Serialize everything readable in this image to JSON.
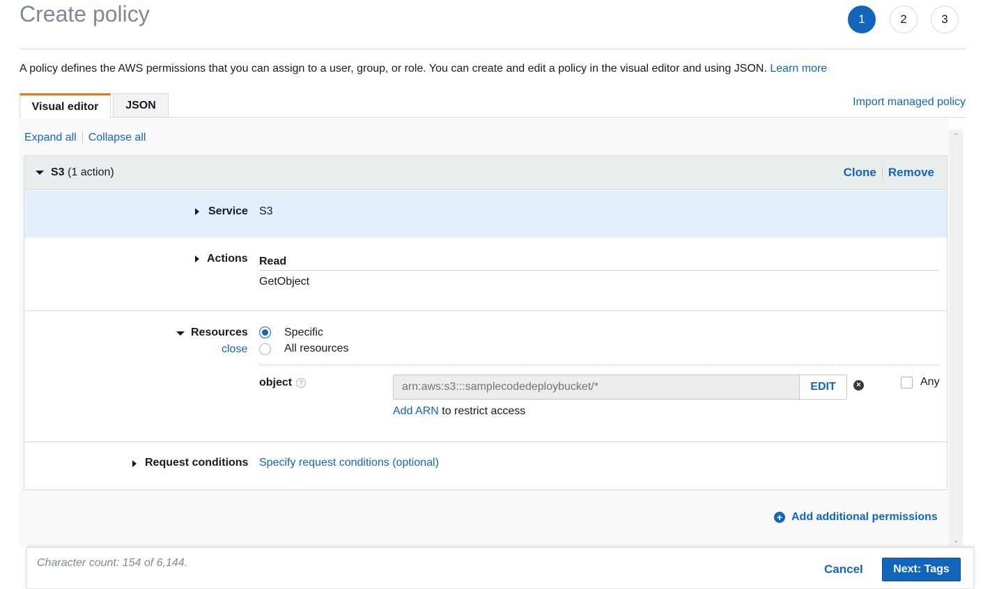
{
  "header": {
    "title": "Create policy",
    "steps": [
      "1",
      "2",
      "3"
    ],
    "description": "A policy defines the AWS permissions that you can assign to a user, group, or role. You can create and edit a policy in the visual editor and using JSON.",
    "learn_more": "Learn more"
  },
  "tabs": {
    "visual": "Visual editor",
    "json": "JSON",
    "import_link": "Import managed policy"
  },
  "toolbar": {
    "expand_all": "Expand all",
    "collapse_all": "Collapse all"
  },
  "permission": {
    "service_short": "S3",
    "action_count": "(1 action)",
    "clone": "Clone",
    "remove": "Remove",
    "service_label": "Service",
    "service_value": "S3",
    "actions_label": "Actions",
    "access_level": "Read",
    "action": "GetObject",
    "resources_label": "Resources",
    "close_link": "close",
    "radio_specific": "Specific",
    "radio_all": "All resources",
    "resource_type": "object",
    "arn_value": "arn:aws:s3:::samplecodedeploybucket/*",
    "edit": "EDIT",
    "any": "Any",
    "add_arn": "Add ARN",
    "restrict_text": "to restrict access",
    "conditions_label": "Request conditions",
    "conditions_link": "Specify request conditions (optional)"
  },
  "add_permissions": "Add additional permissions",
  "footer": {
    "char_count": "Character count: 154 of 6,144.",
    "cancel": "Cancel",
    "next": "Next: Tags"
  },
  "colors": {
    "link": "#1166bb",
    "tab_accent": "#ec7211",
    "service_row_bg": "#e3f0fb",
    "primary_button": "#1166bb"
  }
}
